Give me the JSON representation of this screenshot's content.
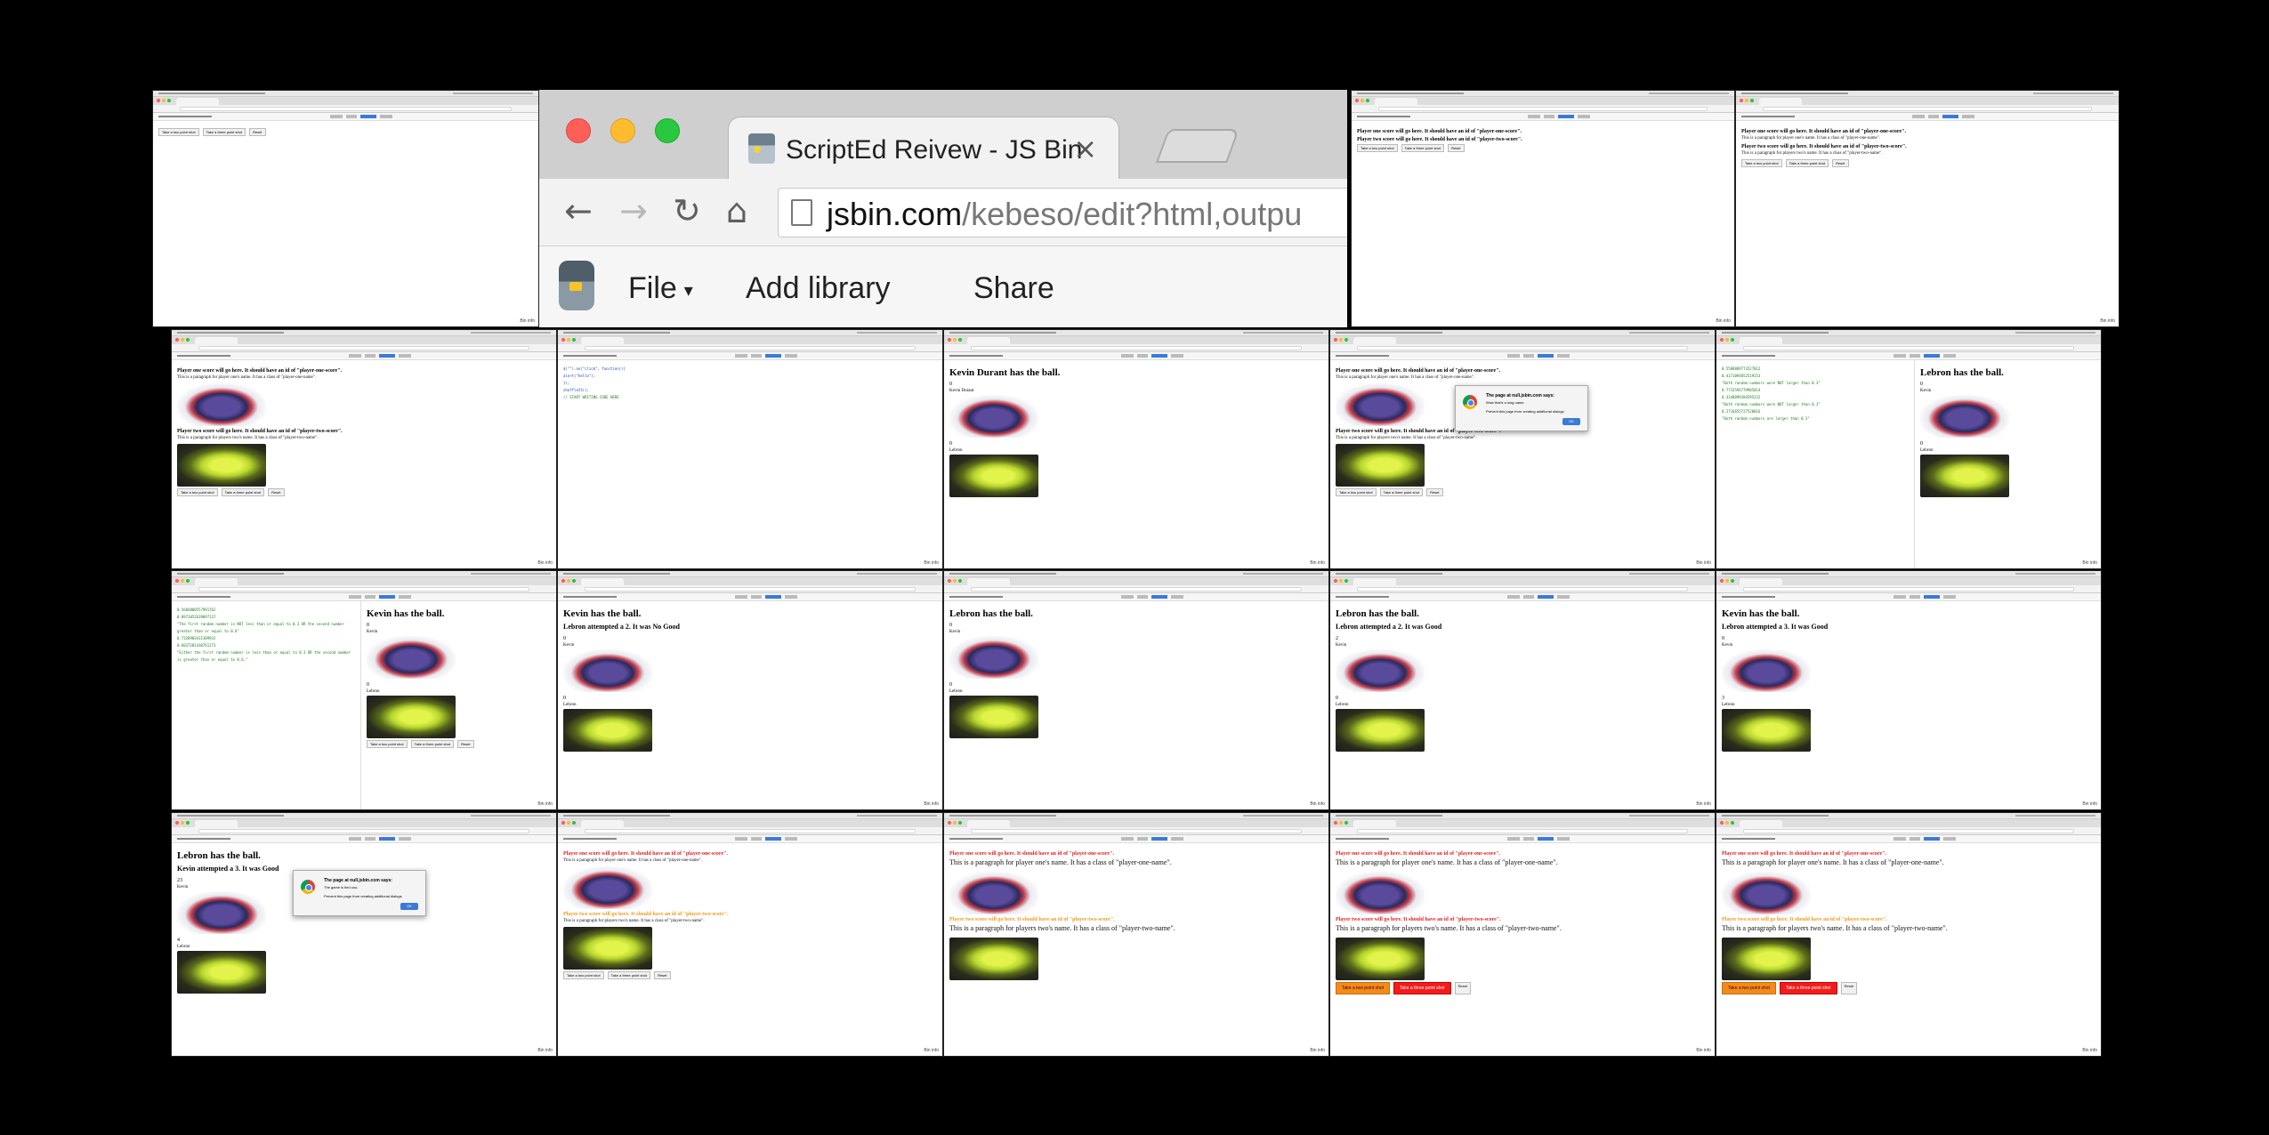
{
  "zoomed_window": {
    "tab_title": "ScriptEd Reivew - JS Bin",
    "tab_close": "×",
    "url_host": "jsbin.com",
    "url_path": "/kebeso/edit?html,outpu",
    "nav": {
      "back": "←",
      "forward": "→",
      "reload": "↻",
      "home": "⌂"
    },
    "menu": {
      "file": "File",
      "file_caret": "▾",
      "add_library": "Add library",
      "share": "Share"
    }
  },
  "common": {
    "bin_info": "Bin info",
    "player_one_heading": "Player one score will go here. It should have an id of \"player-one-score\".",
    "player_one_paragraph": "This is a paragraph for player one's name. It has a class of \"player-one-name\".",
    "player_two_heading": "Player two score will go here. It should have an id of \"player-two-score\".",
    "player_two_paragraph": "This is a paragraph for players two's name. It has a class of \"player-two-name\".",
    "btn_two": "Take a two point shot",
    "btn_three": "Take a three point shot",
    "btn_reset": "Reset",
    "kevin": "Kevin",
    "lebron": "Lebron",
    "kevin_durant": "Kevin Durant",
    "zero": "0"
  },
  "screens": {
    "kd_has_ball": "Kevin Durant has the ball.",
    "kevin_has_ball": "Kevin has the ball.",
    "lebron_has_ball": "Lebron has the ball.",
    "lebron_no_good": "Lebron attempted a 2. It was No Good",
    "lebron_two_good": "Lebron attempted a 2. It was Good",
    "lebron_three_good": "Lebron attempted a 3. It was Good",
    "kevin_three_good": "Kevin attempted a 3. It was Good",
    "score_two": "2",
    "score_three": "3",
    "score_twentythree": "23",
    "score_four": "4"
  },
  "alert": {
    "title": "The page at null.jsbin.com says:",
    "line1": "Wow that's a long name.",
    "line1b": "The game is tied ooo.",
    "line2": "Prevent this page from creating additional dialogs",
    "ok": "OK"
  },
  "code_sample": {
    "lines": [
      "$(\"\").on(\"click\", function(){",
      "  alert(\"hello\");",
      "});",
      "shuffleIt();",
      "// START WRITING CODE HERE"
    ]
  },
  "console_lines": [
    "0.5588889773527012",
    "0.4171094852519153",
    "\"Both random numbers were NOT larger than 0.3\"",
    "0.7733594779985014",
    "0.3248099384595232",
    "\"Both random numbers were NOT larger than 0.3\"",
    "0.2716655727520016",
    "\"Both random numbers are larger than 0.3\""
  ],
  "console_lines_b": [
    "0.5684800557991762",
    "0.8971052639097137",
    "\"The first random number is NOT less than or equal to 0.3 OR the second number greater than or equal to 0.6\"",
    "0.7328903411309932",
    "0.6037201430761273",
    "\"Either the first random number is less than or equal to 0.3 OR the second number is greater than or equal to 0.6.\""
  ]
}
